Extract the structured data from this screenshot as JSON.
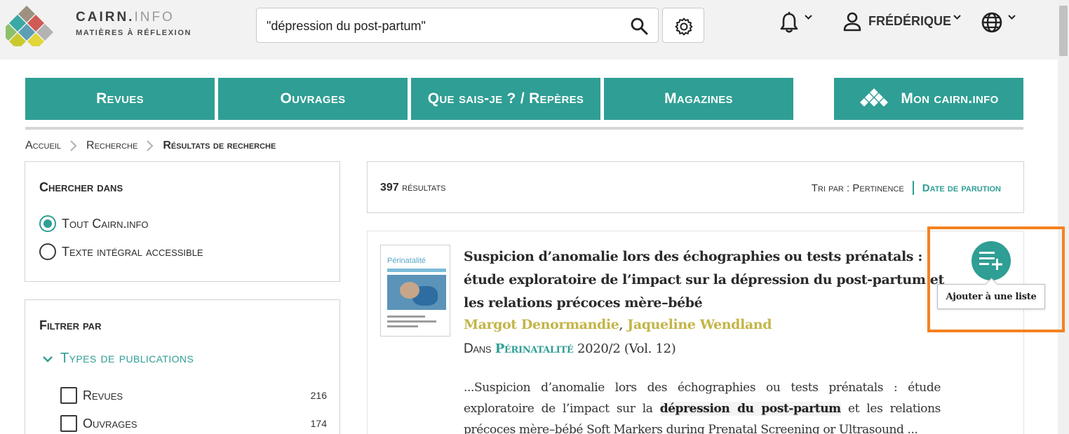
{
  "header": {
    "logo_name_main": "CAIRN.",
    "logo_name_dim": "INFO",
    "logo_tagline": "MATIÈRES À RÉFLEXION",
    "search_value": "\"dépression du post-partum\"",
    "user_name": "FRÉDÉRIQUE",
    "icons": {
      "search": "search-icon",
      "settings": "gear-icon",
      "notifications": "bell-icon",
      "user": "user-icon",
      "language": "globe-icon"
    }
  },
  "nav": {
    "revues": "Revues",
    "ouvrages": "Ouvrages",
    "que_sais_je": "Que sais-je ? / Repères",
    "magazines": "Magazines",
    "mon_cairn": "Mon cairn.info"
  },
  "breadcrumb": {
    "home": "Accueil",
    "search": "Recherche",
    "current": "Résultats de recherche"
  },
  "sidebar": {
    "search_in": {
      "title": "Chercher dans",
      "options": [
        {
          "label": "Tout Cairn.info",
          "selected": true
        },
        {
          "label": "Texte intégral accessible",
          "selected": false
        }
      ]
    },
    "filter": {
      "title": "Filtrer par",
      "facet_title": "Types de publications",
      "items": [
        {
          "label": "Revues",
          "count": "216"
        },
        {
          "label": "Ouvrages",
          "count": "174"
        }
      ]
    }
  },
  "results": {
    "count": "397",
    "count_label": "résultats",
    "sort_label": "Tri par : Pertinence",
    "sort_alt": "Date de parution",
    "items": [
      {
        "title": "Suspicion d’anomalie lors des échographies ou tests prénatals : étude exploratoire de l’impact sur la dépression du post-partum et les relations précoces mère–bébé",
        "authors": [
          "Margot Denormandie",
          "Jaqueline Wendland"
        ],
        "author_sep": ",",
        "source_prefix": "Dans",
        "journal": "Périnatalité",
        "issue": "2020/2 (Vol. 12)",
        "cover_title": "Périnatalité",
        "snippet_before": "...Suspicion d’anomalie lors des échographies ou tests prénatals : étude exploratoire de l’impact sur la ",
        "snippet_highlight": "dépression du post-partum",
        "snippet_after": " et les relations précoces mère–bébé Soft Markers during Prenatal Screening or Ultrasound ..."
      }
    ]
  },
  "add_to_list": {
    "tooltip": "Ajouter à une liste",
    "icon": "playlist-add-icon"
  },
  "colors": {
    "accent": "#2f9e94",
    "author": "#c3b548",
    "highlight_box": "#f58220"
  }
}
